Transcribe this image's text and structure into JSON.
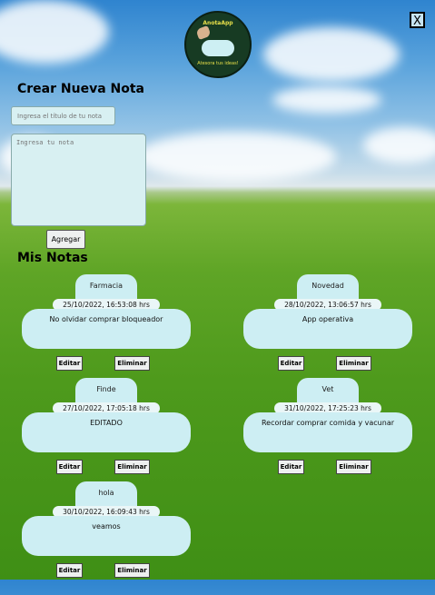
{
  "logo": {
    "title": "AnotaApp",
    "subtitle": "Atesora tus ideas!"
  },
  "close_label": "X",
  "create": {
    "heading": "Crear Nueva Nota",
    "title_placeholder": "Ingresa el título de tu nota",
    "body_placeholder": "Ingresa tu nota",
    "add_label": "Agregar"
  },
  "notes_heading": "Mis Notas",
  "notes": [
    {
      "title": "Farmacia",
      "date": "25/10/2022, 16:53:08 hrs",
      "body": "No olvidar comprar bloqueador",
      "edit": "Editar",
      "delete": "Eliminar"
    },
    {
      "title": "Novedad",
      "date": "28/10/2022, 13:06:57 hrs",
      "body": "App operativa",
      "edit": "Editar",
      "delete": "Eliminar"
    },
    {
      "title": "Finde",
      "date": "27/10/2022, 17:05:18 hrs",
      "body": "EDITADO",
      "edit": "Editar",
      "delete": "Eliminar"
    },
    {
      "title": "Vet",
      "date": "31/10/2022, 17:25:23 hrs",
      "body": "Recordar comprar comida y vacunar",
      "edit": "Editar",
      "delete": "Eliminar"
    },
    {
      "title": "hola",
      "date": "30/10/2022, 16:09:43 hrs",
      "body": "veamos",
      "edit": "Editar",
      "delete": "Eliminar"
    }
  ]
}
